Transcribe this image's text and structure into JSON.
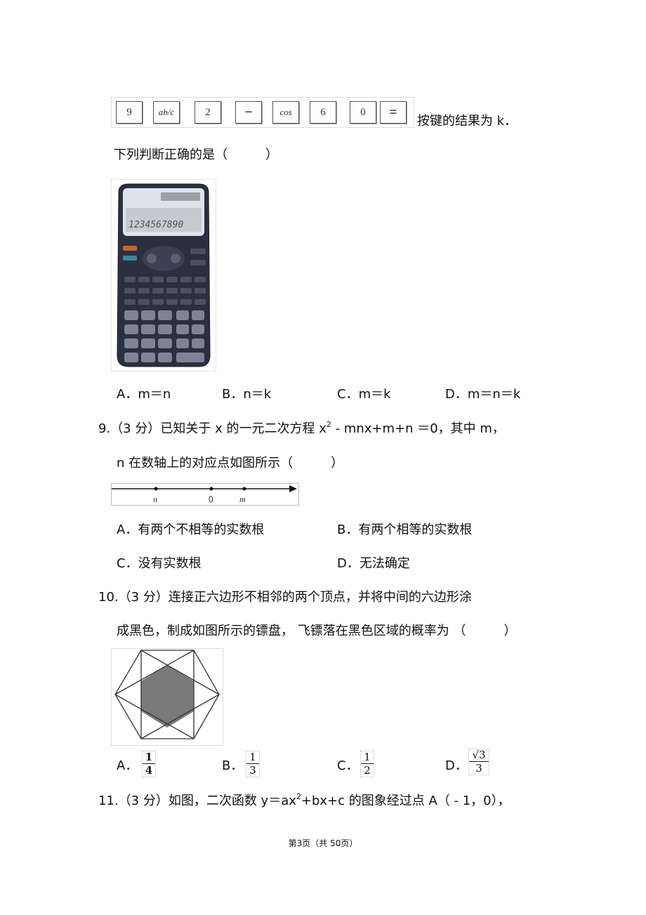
{
  "q8": {
    "keys": [
      "9",
      "ab/c",
      "2",
      "−",
      "cos",
      "6",
      "0",
      "="
    ],
    "keys_suffix": "按键的结果为  k．",
    "prompt": "下列判断正确的是（　　　）",
    "calculator_display": "1234567890",
    "options": [
      {
        "label": "A．",
        "text": "m＝n"
      },
      {
        "label": "B．",
        "text": "n＝k"
      },
      {
        "label": "C．",
        "text": "m＝k"
      },
      {
        "label": "D．",
        "text": "m＝n＝k"
      }
    ]
  },
  "q9": {
    "number": "9.",
    "score": "（3 分）",
    "line1_a": "已知关于  x 的一元二次方程  x",
    "line1_sup": "2",
    "line1_b": " - mnx+m+n ＝0，其中 m，",
    "line2": "n 在数轴上的对应点如图所示（　　　）",
    "numberline_labels": [
      "n",
      "0",
      "m"
    ],
    "options": [
      {
        "label": "A．",
        "text": "有两个不相等的实数根"
      },
      {
        "label": "B．",
        "text": "有两个相等的实数根"
      },
      {
        "label": "C．",
        "text": "没有实数根"
      },
      {
        "label": "D．",
        "text": "无法确定"
      }
    ]
  },
  "q10": {
    "number": "10.",
    "score": "（3 分）",
    "line1": "连接正六边形不相邻的两个顶点，并将中间的六边形涂",
    "line2": "成黑色，制成如图所示的镖盘， 飞镖落在黑色区域的概率为  （　　　）",
    "options": [
      {
        "label": "A．",
        "num": "1",
        "den": "4"
      },
      {
        "label": "B．",
        "num": "1",
        "den": "3"
      },
      {
        "label": "C．",
        "num": "1",
        "den": "2"
      },
      {
        "label": "D．",
        "num": "√3",
        "den": "3"
      }
    ]
  },
  "q11": {
    "number": "11.",
    "score": "（3 分）",
    "text_a": "如图，二次函数  y＝ax",
    "text_sup": "2",
    "text_b": "+bx+c 的图象经过点  A（ - 1，0），"
  },
  "footer": {
    "page_text": "第3页（共 50页）"
  }
}
